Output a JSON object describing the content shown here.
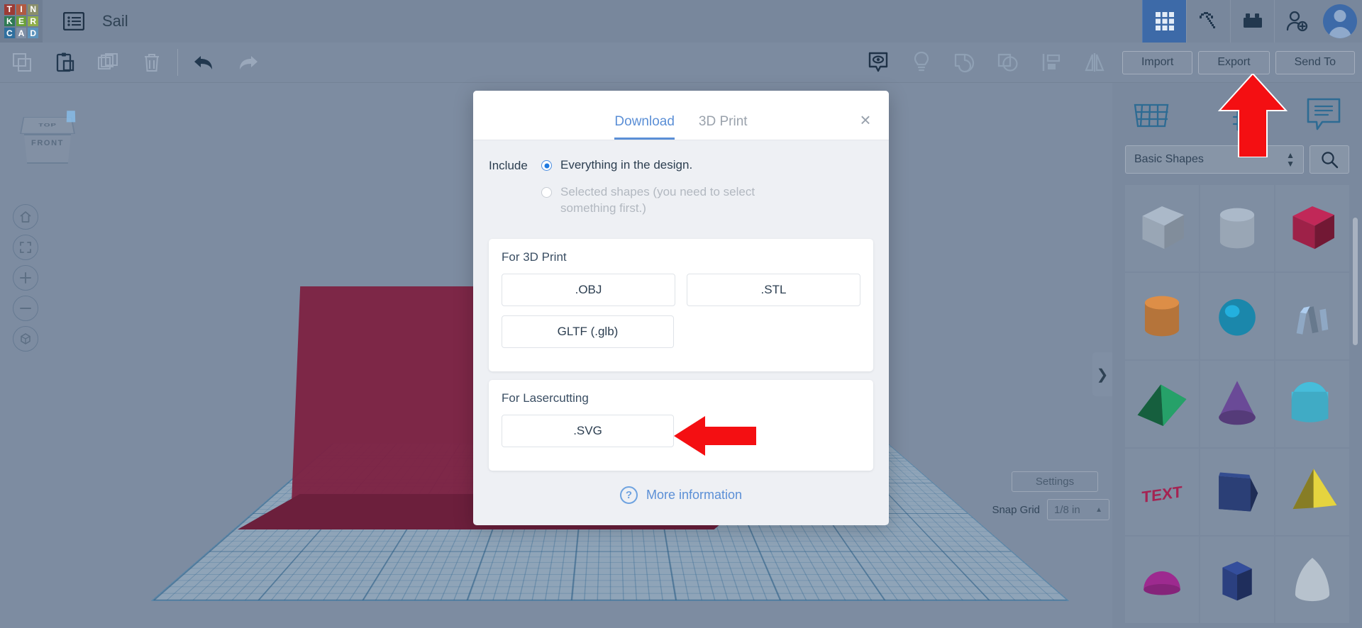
{
  "header": {
    "logo_letters": [
      "T",
      "I",
      "N",
      "K",
      "E",
      "R",
      "C",
      "A",
      "D"
    ],
    "logo_colors": [
      "#9c3b35",
      "#b05a42",
      "#8a8f6b",
      "#2f7a54",
      "#6aa03a",
      "#8fae4a",
      "#2f6f9e",
      "#7f8fa6",
      "#5c93bc"
    ],
    "menu_icon": "hamburger-list-icon",
    "doc_title": "Sail",
    "right_icons": [
      {
        "name": "grid-apps-icon",
        "active": true
      },
      {
        "name": "pickaxe-minecraft-icon",
        "active": false
      },
      {
        "name": "lego-brick-icon",
        "active": false
      },
      {
        "name": "add-person-icon",
        "active": false
      }
    ],
    "avatar_name": "user-avatar"
  },
  "toolbar": {
    "left_icons": [
      {
        "name": "copy-icon",
        "enabled": false
      },
      {
        "name": "paste-icon",
        "enabled": true
      },
      {
        "name": "duplicate-icon",
        "enabled": false
      },
      {
        "name": "delete-trash-icon",
        "enabled": false
      },
      {
        "name": "undo-icon",
        "enabled": true
      },
      {
        "name": "redo-icon",
        "enabled": false
      }
    ],
    "right_icons": [
      {
        "name": "show-hide-eye-icon",
        "enabled": true
      },
      {
        "name": "lightbulb-icon",
        "enabled": false
      },
      {
        "name": "group-shapes-icon",
        "enabled": false
      },
      {
        "name": "ungroup-shapes-icon",
        "enabled": false
      },
      {
        "name": "align-icon",
        "enabled": false
      },
      {
        "name": "mirror-flip-icon",
        "enabled": false
      }
    ],
    "import_label": "Import",
    "export_label": "Export",
    "sendto_label": "Send To"
  },
  "viewport": {
    "cube_top_label": "TOP",
    "cube_front_label": "FRONT",
    "controls": [
      {
        "name": "home-view-button",
        "glyph": "home"
      },
      {
        "name": "fit-to-view-button",
        "glyph": "fit"
      },
      {
        "name": "zoom-in-button",
        "glyph": "+"
      },
      {
        "name": "zoom-out-button",
        "glyph": "−"
      },
      {
        "name": "ortho-perspective-toggle",
        "glyph": "cube"
      }
    ]
  },
  "status": {
    "settings_label": "Settings",
    "snap_grid_label": "Snap Grid",
    "snap_grid_value": "1/8 in",
    "snap_grid_caret": "▲"
  },
  "shapes_panel": {
    "top_icons": [
      {
        "name": "workplane-icon"
      },
      {
        "name": "ruler-icon"
      },
      {
        "name": "notes-comment-icon"
      }
    ],
    "category_value": "Basic Shapes",
    "category_spinner": "⬍",
    "search_icon": "search-icon",
    "collapse_handle": "❯",
    "shapes": [
      {
        "name": "box-hollow",
        "color": "#b9c3cd",
        "kind": "box-hollow"
      },
      {
        "name": "cylinder-hollow",
        "color": "#b9c3cd",
        "kind": "cyl-hollow"
      },
      {
        "name": "box-red",
        "color": "#9e2148",
        "kind": "box"
      },
      {
        "name": "cylinder-orange",
        "color": "#b5743a",
        "kind": "cyl"
      },
      {
        "name": "sphere-teal",
        "color": "#1b87ab",
        "kind": "sphere"
      },
      {
        "name": "scribble-blue",
        "color": "#8fa8c4",
        "kind": "scribble"
      },
      {
        "name": "wedge-green",
        "color": "#1f8456",
        "kind": "wedge"
      },
      {
        "name": "cone-purple",
        "color": "#6a4a97",
        "kind": "cone"
      },
      {
        "name": "roof-teal",
        "color": "#3a9bb3",
        "kind": "dome"
      },
      {
        "name": "text-red",
        "color": "#a52352",
        "kind": "text"
      },
      {
        "name": "wedge-navy",
        "color": "#2b3f76",
        "kind": "slab"
      },
      {
        "name": "pyramid-yellow",
        "color": "#bcae34",
        "kind": "pyramid"
      },
      {
        "name": "halfsphere-magenta",
        "color": "#9d2a8f",
        "kind": "half-sphere"
      },
      {
        "name": "polygon-blue",
        "color": "#2b4080",
        "kind": "prism"
      },
      {
        "name": "paraboloid-gray",
        "color": "#b7c2cd",
        "kind": "parab"
      }
    ]
  },
  "modal": {
    "tabs": [
      {
        "label": "Download",
        "active": true
      },
      {
        "label": "3D Print",
        "active": false
      }
    ],
    "close_label": "×",
    "include_label": "Include",
    "options": [
      {
        "label": "Everything in the design.",
        "checked": true,
        "disabled": false
      },
      {
        "label": "Selected shapes (you need to select something first.)",
        "checked": false,
        "disabled": true
      }
    ],
    "sections": [
      {
        "title": "For 3D Print",
        "buttons": [
          ".OBJ",
          ".STL",
          "GLTF (.glb)"
        ]
      },
      {
        "title": "For Lasercutting",
        "buttons": [
          ".SVG"
        ]
      }
    ],
    "more_info_label": "More information",
    "more_info_icon": "question-circle-icon"
  },
  "annotations": {
    "arrow_color": "#f40f12",
    "arrow_up_name": "arrow-pointing-to-export",
    "arrow_left_name": "arrow-pointing-to-svg"
  },
  "colors": {
    "app_bg": "#7d8ca1",
    "accent_blue": "#5b8fd6",
    "model_red": "#7d2244"
  }
}
